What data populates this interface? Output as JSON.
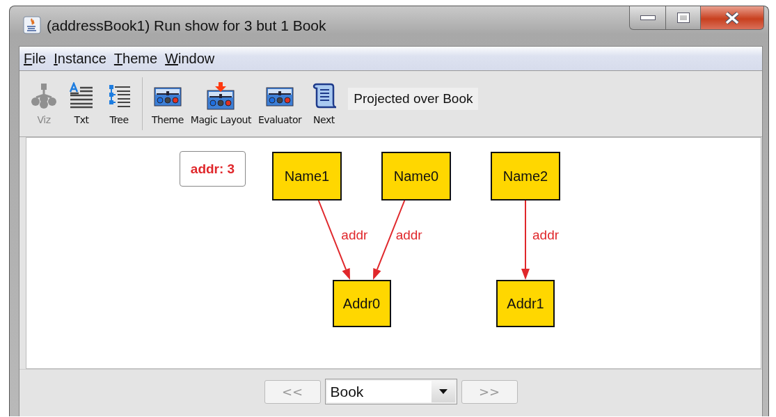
{
  "window": {
    "title": "(addressBook1) Run show for 3 but 1 Book"
  },
  "menu": [
    {
      "label": "File",
      "underlined_first": true
    },
    {
      "label": "Instance",
      "underlined_first": true
    },
    {
      "label": "Theme",
      "underlined_first": true
    },
    {
      "label": "Window",
      "underlined_first": true
    }
  ],
  "toolbar": {
    "groups": [
      {
        "buttons": [
          {
            "label": "Viz",
            "kind": "viz",
            "disabled": true
          },
          {
            "label": "Txt",
            "kind": "txt",
            "disabled": false
          },
          {
            "label": "Tree",
            "kind": "tree",
            "disabled": false
          }
        ]
      },
      {
        "buttons": [
          {
            "label": "Theme",
            "kind": "theme",
            "disabled": false
          },
          {
            "label": "Magic Layout",
            "kind": "magic",
            "disabled": false
          },
          {
            "label": "Evaluator",
            "kind": "theme",
            "disabled": false
          },
          {
            "label": "Next",
            "kind": "scroll",
            "disabled": false
          }
        ]
      }
    ],
    "status": "Projected over Book"
  },
  "graph": {
    "legend": "addr: 3",
    "groups": [
      {
        "target": "Addr0",
        "sources": [
          {
            "label": "Name1",
            "edge_label": "addr"
          },
          {
            "label": "Name0",
            "edge_label": "addr"
          }
        ]
      },
      {
        "target": "Addr1",
        "sources": [
          {
            "label": "Name2",
            "edge_label": "addr"
          }
        ]
      }
    ]
  },
  "navigation": {
    "previous": {
      "label": "<<",
      "disabled": true
    },
    "projection": {
      "value": "Book"
    },
    "next": {
      "label": ">>",
      "disabled": true
    }
  }
}
